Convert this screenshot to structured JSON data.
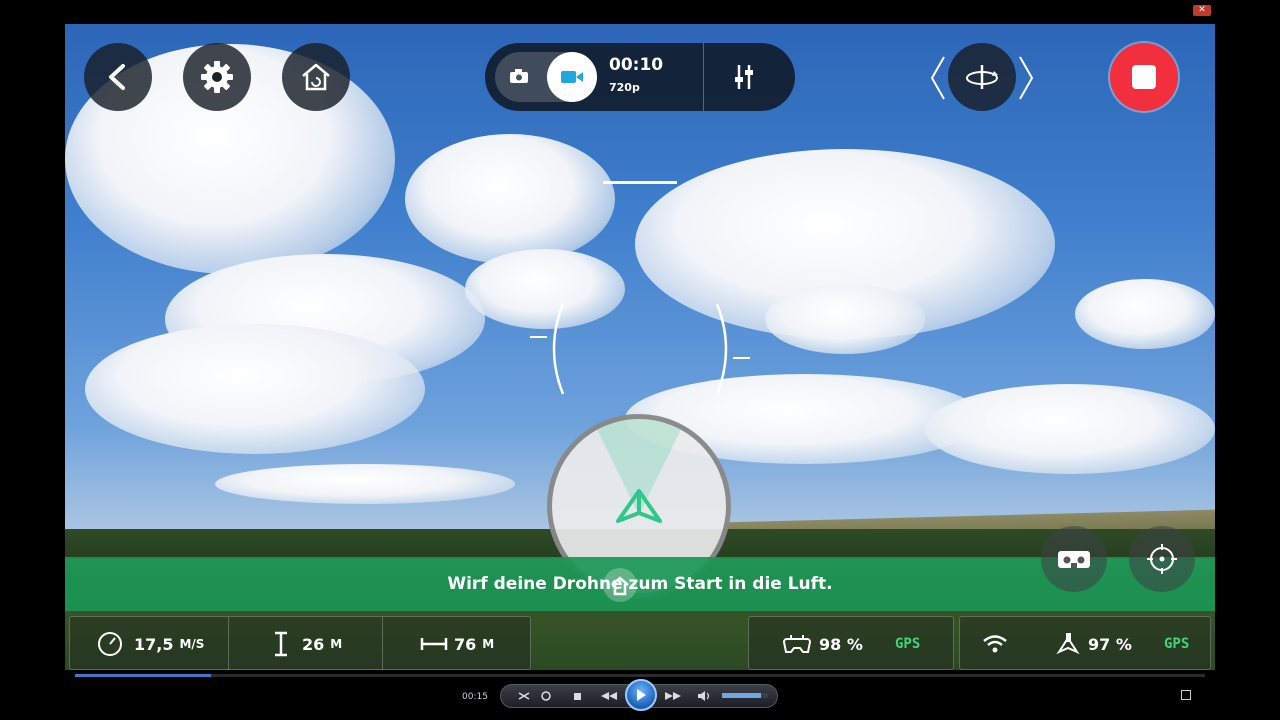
{
  "window": {
    "close_label": "✕"
  },
  "controls": {
    "back": "back",
    "settings": "settings",
    "return_home": "return-home",
    "mode": {
      "photo": "photo",
      "video": "video"
    },
    "record_time": "00:10",
    "resolution": "720p",
    "adjust": "adjust",
    "orbit": "orbit",
    "record": "record"
  },
  "banner": {
    "message": "Wirf deine Drohne zum Start in die Luft."
  },
  "telemetry": {
    "speed": {
      "value": "17,5",
      "unit": "M/S"
    },
    "altitude": {
      "value": "26",
      "unit": "M"
    },
    "distance": {
      "value": "76",
      "unit": "M"
    },
    "controller_battery": {
      "value": "98 %",
      "gps": "GPS"
    },
    "drone_battery": {
      "value": "97 %",
      "gps": "GPS"
    }
  },
  "player": {
    "elapsed": "00:15",
    "progress": 0.12,
    "volume": 0.85
  },
  "colors": {
    "record": "#f22f3c",
    "banner": "#1b9655",
    "accent": "#2dc88a",
    "gps": "#3fd67a"
  }
}
